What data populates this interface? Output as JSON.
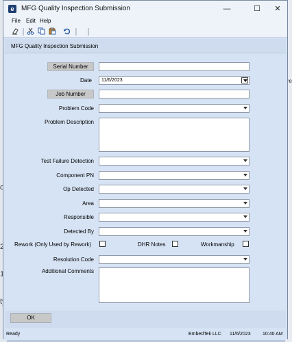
{
  "background": {
    "left_fragments": [
      "2",
      "1",
      "ty",
      "cti"
    ],
    "right_fragments": [
      "re"
    ]
  },
  "window": {
    "title": "MFG Quality Inspection Submission",
    "app_icon_text": "e",
    "controls": {
      "minimize": "—",
      "maximize": "☐",
      "close": "✕"
    }
  },
  "menu": {
    "file": "File",
    "edit": "Edit",
    "help": "Help"
  },
  "toolbar": {
    "icons": [
      "eraser-icon",
      "cut-icon",
      "copy-icon",
      "paste-icon",
      "undo-icon"
    ]
  },
  "form": {
    "header": "MFG Quality Inspection Submission",
    "serial_number_label": "Serial Number",
    "serial_number_value": "",
    "date_label": "Date",
    "date_value": "11/6/2023",
    "job_number_label": "Job Number",
    "job_number_value": "",
    "problem_code_label": "Problem Code",
    "problem_description_label": "Problem Description",
    "test_failure_detection_label": "Test Failure Detection",
    "component_pn_label": "Component PN",
    "op_detected_label": "Op Detected",
    "area_label": "Area",
    "responsible_label": "Responsible",
    "detected_by_label": "Detected By",
    "rework_label": "Rework (Only Used by Rework)",
    "dhr_notes_label": "DHR Notes",
    "workmanship_label": "Workmanship",
    "resolution_code_label": "Resolution Code",
    "additional_comments_label": "Additional Comments",
    "ok_label": "OK"
  },
  "status": {
    "ready": "Ready",
    "company": "EmbedTek LLC",
    "date": "11/6/2023",
    "time": "10:40 AM"
  }
}
